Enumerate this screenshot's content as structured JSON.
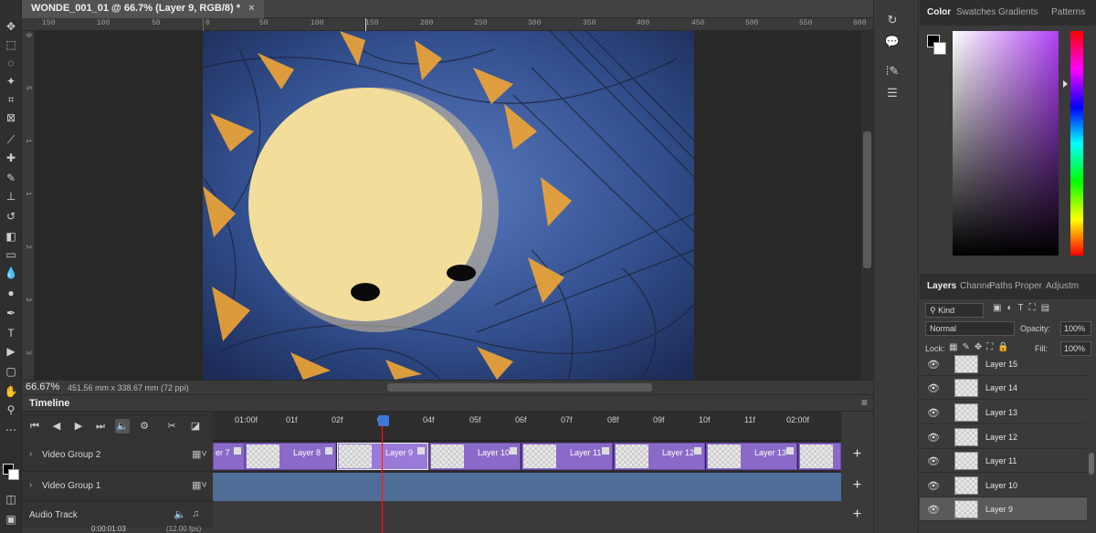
{
  "document": {
    "tab_title": "WONDE_001_01 @ 66.7% (Layer 9, RGB/8) *",
    "close_glyph": "×",
    "zoom": "66.67%",
    "doc_size": "451.56 mm x 338.67 mm (72 ppi)"
  },
  "rulers": {
    "top": [
      "150",
      "100",
      "50",
      "0",
      "50",
      "100",
      "150",
      "200",
      "250",
      "300",
      "350",
      "400",
      "450",
      "500",
      "550",
      "600"
    ],
    "left": [
      "0",
      "5",
      "1",
      "1",
      "2",
      "2",
      "3"
    ]
  },
  "timeline": {
    "title": "Timeline",
    "time_labels": [
      "01:00f",
      "01f",
      "02f",
      "03f",
      "04f",
      "05f",
      "06f",
      "07f",
      "08f",
      "09f",
      "10f",
      "11f",
      "02:00f"
    ],
    "tracks": [
      {
        "name": "Video Group 2"
      },
      {
        "name": "Video Group 1"
      },
      {
        "name": "Audio Track"
      }
    ],
    "clips": [
      "er 7",
      "Layer 8",
      "Layer 9",
      "Layer 10",
      "Layer 11",
      "Layer 12",
      "Layer 13"
    ],
    "current_time": "0:00:01:03",
    "fps": "(12.00 fps)"
  },
  "color_panel": {
    "tabs": [
      "Color",
      "Swatches",
      "Gradients",
      "Patterns"
    ]
  },
  "layers_panel": {
    "tabs": [
      "Layers",
      "Channe",
      "Paths",
      "Proper",
      "Adjustm"
    ],
    "filter_kind": "Kind",
    "blend_mode": "Normal",
    "opacity_label": "Opacity:",
    "opacity_value": "100%",
    "lock_label": "Lock:",
    "fill_label": "Fill:",
    "fill_value": "100%",
    "layers": [
      "Layer 15",
      "Layer 14",
      "Layer 13",
      "Layer 12",
      "Layer 11",
      "Layer 10",
      "Layer 9"
    ],
    "selected_layer": "Layer 9"
  }
}
